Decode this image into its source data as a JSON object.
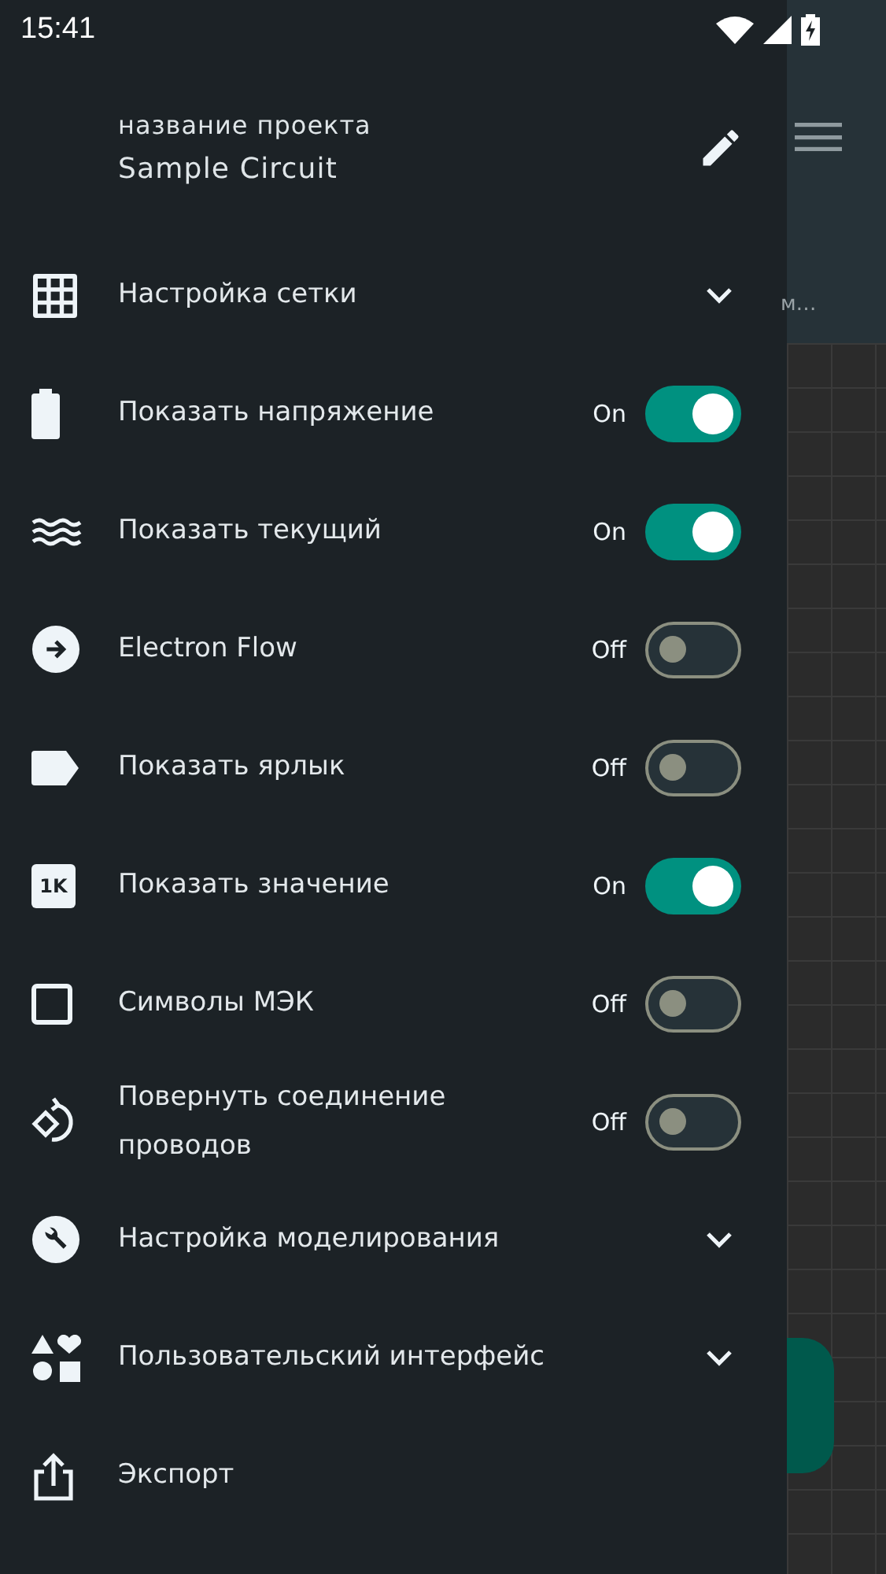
{
  "status_bar": {
    "time": "15:41"
  },
  "background_app": {
    "toolbar_text": "м…"
  },
  "drawer": {
    "header": {
      "label": "название проекта",
      "title": "Sample Circuit"
    },
    "items": [
      {
        "kind": "expander",
        "label": "Настройка сетки",
        "expanded": false
      },
      {
        "kind": "toggle",
        "label": "Показать напряжение",
        "state_text": "On",
        "on": true
      },
      {
        "kind": "toggle",
        "label": "Показать текущий",
        "state_text": "On",
        "on": true
      },
      {
        "kind": "toggle",
        "label": "Electron Flow",
        "state_text": "Off",
        "on": false
      },
      {
        "kind": "toggle",
        "label": "Показать ярлык",
        "state_text": "Off",
        "on": false
      },
      {
        "kind": "toggle",
        "label": "Показать значение",
        "state_text": "On",
        "on": true,
        "icon_text": "1K"
      },
      {
        "kind": "toggle",
        "label": "Символы МЭК",
        "state_text": "Off",
        "on": false
      },
      {
        "kind": "toggle",
        "label": "Повернуть соединение проводов",
        "state_text": "Off",
        "on": false
      },
      {
        "kind": "expander",
        "label": "Настройка моделирования",
        "expanded": false
      },
      {
        "kind": "expander",
        "label": "Пользовательский интерфейс",
        "expanded": false
      },
      {
        "kind": "action",
        "label": "Экспорт"
      }
    ]
  }
}
